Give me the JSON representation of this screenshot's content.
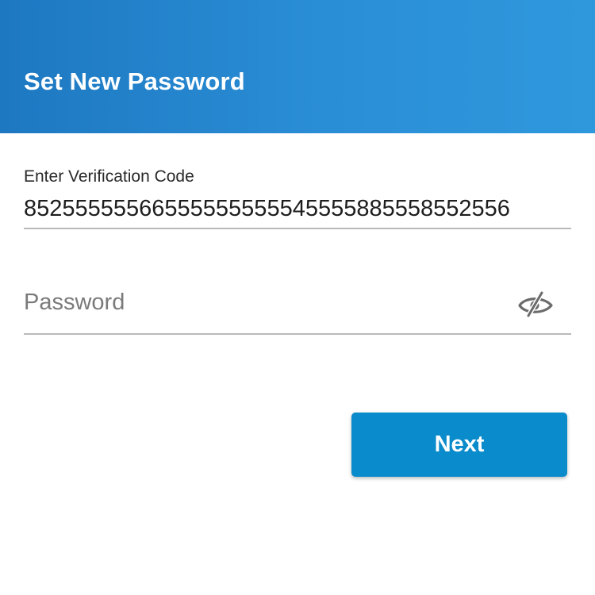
{
  "header": {
    "title": "Set New Password",
    "gradient_start": "#1d78c1",
    "gradient_end": "#2f98dd"
  },
  "verification": {
    "label": "Enter Verification Code",
    "value": "85255555566555555555545555885558552556"
  },
  "password": {
    "placeholder": "Password",
    "value": "",
    "toggle_icon": "eye-slash-icon"
  },
  "actions": {
    "next_label": "Next",
    "next_color": "#0a8bcb"
  }
}
